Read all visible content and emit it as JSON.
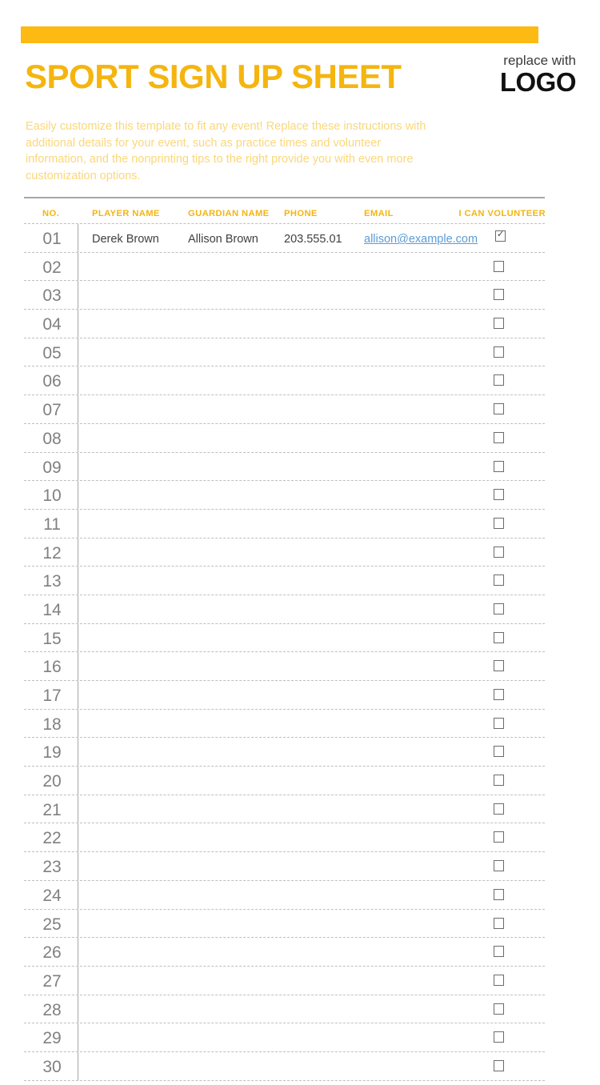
{
  "header": {
    "title": "SPORT SIGN UP SHEET",
    "logo_replace_text": "replace with",
    "logo_word": "LOGO",
    "instructions": "Easily customize this template to fit any event! Replace these instructions with additional details for your event, such as practice times and volunteer information, and the nonprinting tips to the right provide you with even more customization options."
  },
  "colors": {
    "accent_yellow": "#FCBA12",
    "title_yellow": "#F5B50F",
    "instruction_yellow": "#FBD77A",
    "link_blue": "#5B9BD5",
    "row_number_gray": "#808080",
    "rule_gray": "#A6A6A6"
  },
  "table": {
    "columns": [
      "NO.",
      "PLAYER NAME",
      "GUARDIAN NAME",
      "PHONE",
      "EMAIL",
      "I CAN VOLUNTEER"
    ],
    "rows": [
      {
        "no": "01",
        "player": "Derek Brown",
        "guardian": "Allison Brown",
        "phone": "203.555.01",
        "email": "allison@example.com",
        "volunteer": true
      },
      {
        "no": "02",
        "player": "",
        "guardian": "",
        "phone": "",
        "email": "",
        "volunteer": false
      },
      {
        "no": "03",
        "player": "",
        "guardian": "",
        "phone": "",
        "email": "",
        "volunteer": false
      },
      {
        "no": "04",
        "player": "",
        "guardian": "",
        "phone": "",
        "email": "",
        "volunteer": false
      },
      {
        "no": "05",
        "player": "",
        "guardian": "",
        "phone": "",
        "email": "",
        "volunteer": false
      },
      {
        "no": "06",
        "player": "",
        "guardian": "",
        "phone": "",
        "email": "",
        "volunteer": false
      },
      {
        "no": "07",
        "player": "",
        "guardian": "",
        "phone": "",
        "email": "",
        "volunteer": false
      },
      {
        "no": "08",
        "player": "",
        "guardian": "",
        "phone": "",
        "email": "",
        "volunteer": false
      },
      {
        "no": "09",
        "player": "",
        "guardian": "",
        "phone": "",
        "email": "",
        "volunteer": false
      },
      {
        "no": "10",
        "player": "",
        "guardian": "",
        "phone": "",
        "email": "",
        "volunteer": false
      },
      {
        "no": "11",
        "player": "",
        "guardian": "",
        "phone": "",
        "email": "",
        "volunteer": false
      },
      {
        "no": "12",
        "player": "",
        "guardian": "",
        "phone": "",
        "email": "",
        "volunteer": false
      },
      {
        "no": "13",
        "player": "",
        "guardian": "",
        "phone": "",
        "email": "",
        "volunteer": false
      },
      {
        "no": "14",
        "player": "",
        "guardian": "",
        "phone": "",
        "email": "",
        "volunteer": false
      },
      {
        "no": "15",
        "player": "",
        "guardian": "",
        "phone": "",
        "email": "",
        "volunteer": false
      },
      {
        "no": "16",
        "player": "",
        "guardian": "",
        "phone": "",
        "email": "",
        "volunteer": false
      },
      {
        "no": "17",
        "player": "",
        "guardian": "",
        "phone": "",
        "email": "",
        "volunteer": false
      },
      {
        "no": "18",
        "player": "",
        "guardian": "",
        "phone": "",
        "email": "",
        "volunteer": false
      },
      {
        "no": "19",
        "player": "",
        "guardian": "",
        "phone": "",
        "email": "",
        "volunteer": false
      },
      {
        "no": "20",
        "player": "",
        "guardian": "",
        "phone": "",
        "email": "",
        "volunteer": false
      },
      {
        "no": "21",
        "player": "",
        "guardian": "",
        "phone": "",
        "email": "",
        "volunteer": false
      },
      {
        "no": "22",
        "player": "",
        "guardian": "",
        "phone": "",
        "email": "",
        "volunteer": false
      },
      {
        "no": "23",
        "player": "",
        "guardian": "",
        "phone": "",
        "email": "",
        "volunteer": false
      },
      {
        "no": "24",
        "player": "",
        "guardian": "",
        "phone": "",
        "email": "",
        "volunteer": false
      },
      {
        "no": "25",
        "player": "",
        "guardian": "",
        "phone": "",
        "email": "",
        "volunteer": false
      },
      {
        "no": "26",
        "player": "",
        "guardian": "",
        "phone": "",
        "email": "",
        "volunteer": false
      },
      {
        "no": "27",
        "player": "",
        "guardian": "",
        "phone": "",
        "email": "",
        "volunteer": false
      },
      {
        "no": "28",
        "player": "",
        "guardian": "",
        "phone": "",
        "email": "",
        "volunteer": false
      },
      {
        "no": "29",
        "player": "",
        "guardian": "",
        "phone": "",
        "email": "",
        "volunteer": false
      },
      {
        "no": "30",
        "player": "",
        "guardian": "",
        "phone": "",
        "email": "",
        "volunteer": false
      }
    ]
  }
}
